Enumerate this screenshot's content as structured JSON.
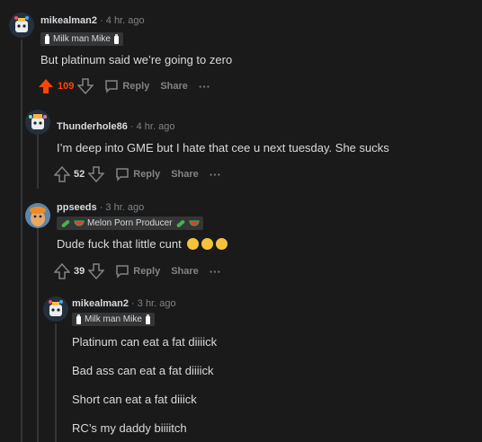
{
  "comments": [
    {
      "username": "mikealman2",
      "time": "· 4 hr. ago",
      "flair": "Milk man Mike",
      "flair_icon_left": "milk-bottle-icon",
      "flair_icon_right": "milk-bottle-icon",
      "body": "But platinum said we’re going to zero",
      "score": "109",
      "upvoted": true,
      "reply": "Reply",
      "share": "Share",
      "more": "···"
    },
    {
      "username": "Thunderhole86",
      "time": "· 4 hr. ago",
      "body": "I’m deep into GME but I hate that cee u next tuesday. She sucks",
      "score": "52",
      "reply": "Reply",
      "share": "Share",
      "more": "···"
    },
    {
      "username": "ppseeds",
      "time": "· 3 hr. ago",
      "flair": "Melon Porn Producer",
      "flair_icons": [
        "cucumber-icon",
        "watermelon-icon"
      ],
      "body": "Dude fuck that little cunt",
      "body_emojis": [
        "laughing-emoji",
        "laughing-emoji",
        "laughing-emoji"
      ],
      "score": "39",
      "reply": "Reply",
      "share": "Share",
      "more": "···"
    },
    {
      "username": "mikealman2",
      "time": "· 3 hr. ago",
      "flair": "Milk man Mike",
      "lines": [
        "Platinum can eat a fat diiiick",
        "Bad ass can eat a fat diiiick",
        "Short can eat a fat diiick",
        "RC’s my daddy biiiitch"
      ]
    }
  ],
  "colors": {
    "background": "#1a1a1b",
    "text": "#d7dadc",
    "muted": "#818384",
    "upvote": "#ff4500",
    "flair_bg": "#343536"
  }
}
